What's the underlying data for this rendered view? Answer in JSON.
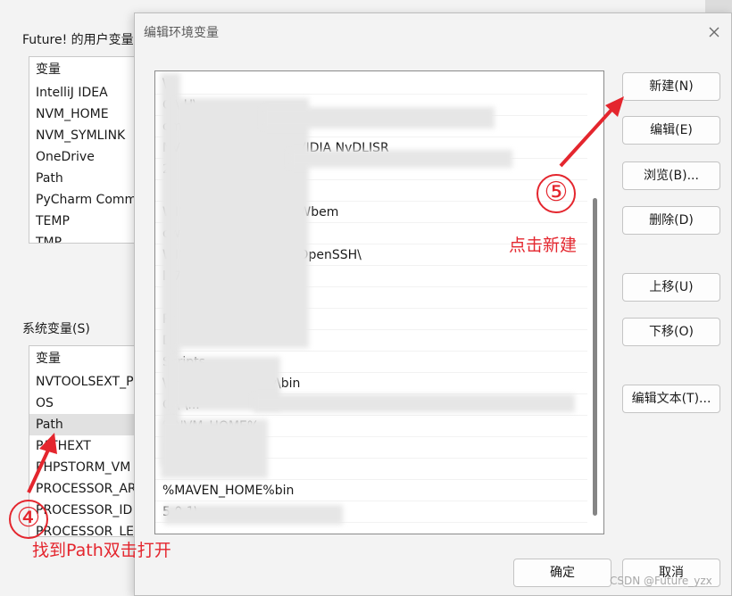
{
  "background": {
    "user_group_label": "Future! 的用户变量",
    "user_vars": {
      "header": "变量",
      "rows": [
        "IntelliJ IDEA",
        "NVM_HOME",
        "NVM_SYMLINK",
        "OneDrive",
        "Path",
        "PyCharm Comm",
        "TEMP",
        "TMP"
      ]
    },
    "system_group_label": "系统变量(S)",
    "system_vars": {
      "header": "变量",
      "rows": [
        "NVTOOLSEXT_P",
        "OS",
        "Path",
        "PATHEXT",
        "PHPSTORM_VM",
        "PROCESSOR_AR",
        "PROCESSOR_ID",
        "PROCESSOR_LE"
      ]
    }
  },
  "dialog": {
    "title": "编辑环境变量",
    "entries": [
      "\\                        \\",
      "C:\\                     H\\",
      "                                          ommon",
      "         NVIDIA Corporation\\NVIDIA NvDLISR",
      "                    2",
      "",
      "WINDOWS\\System32\\Wbem",
      "                                     owerSh",
      "WINDOWS\\System32\\OpenSSH\\",
      "                              ll 7\\",
      "                                ",
      "Pr",
      "D",
      "              Scripts",
      "\\Anaconda\\Library\\bin",
      "C:\\                                     \\...",
      "%NVM_HOME%",
      "                    K%",
      "",
      "%MAVEN_HOME%bin",
      "                                5.0.1\\"
    ],
    "buttons": {
      "new": "新建(N)",
      "edit": "编辑(E)",
      "browse": "浏览(B)...",
      "delete": "删除(D)",
      "move_up": "上移(U)",
      "move_down": "下移(O)",
      "edit_text": "编辑文本(T)...",
      "ok": "确定",
      "cancel": "取消"
    }
  },
  "annotations": {
    "step4_number": "④",
    "step4_text": "找到Path双击打开",
    "step5_number": "⑤",
    "step5_text": "点击新建",
    "color": "#e4262e"
  },
  "watermark": "CSDN @Future_yzx"
}
